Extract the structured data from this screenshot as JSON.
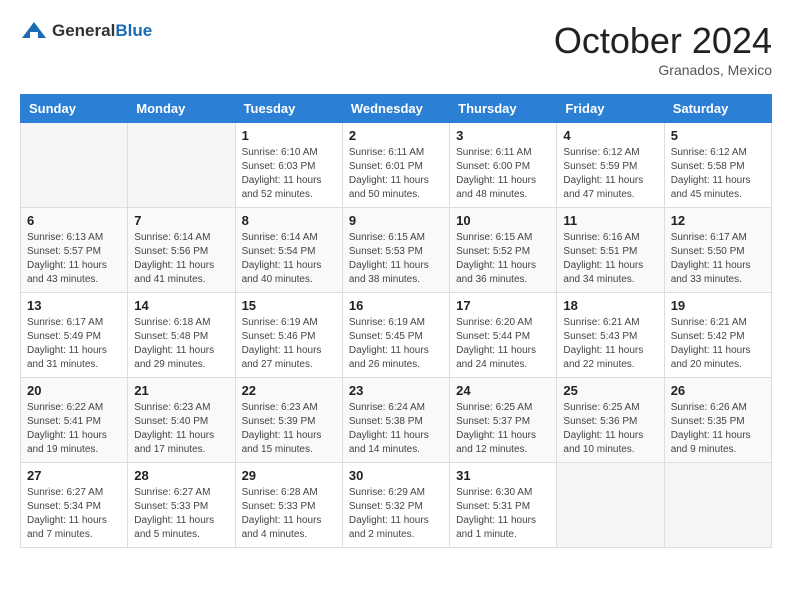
{
  "logo": {
    "general": "General",
    "blue": "Blue"
  },
  "header": {
    "month": "October 2024",
    "location": "Granados, Mexico"
  },
  "weekdays": [
    "Sunday",
    "Monday",
    "Tuesday",
    "Wednesday",
    "Thursday",
    "Friday",
    "Saturday"
  ],
  "weeks": [
    [
      {
        "day": "",
        "sunrise": "",
        "sunset": "",
        "daylight": ""
      },
      {
        "day": "",
        "sunrise": "",
        "sunset": "",
        "daylight": ""
      },
      {
        "day": "1",
        "sunrise": "Sunrise: 6:10 AM",
        "sunset": "Sunset: 6:03 PM",
        "daylight": "Daylight: 11 hours and 52 minutes."
      },
      {
        "day": "2",
        "sunrise": "Sunrise: 6:11 AM",
        "sunset": "Sunset: 6:01 PM",
        "daylight": "Daylight: 11 hours and 50 minutes."
      },
      {
        "day": "3",
        "sunrise": "Sunrise: 6:11 AM",
        "sunset": "Sunset: 6:00 PM",
        "daylight": "Daylight: 11 hours and 48 minutes."
      },
      {
        "day": "4",
        "sunrise": "Sunrise: 6:12 AM",
        "sunset": "Sunset: 5:59 PM",
        "daylight": "Daylight: 11 hours and 47 minutes."
      },
      {
        "day": "5",
        "sunrise": "Sunrise: 6:12 AM",
        "sunset": "Sunset: 5:58 PM",
        "daylight": "Daylight: 11 hours and 45 minutes."
      }
    ],
    [
      {
        "day": "6",
        "sunrise": "Sunrise: 6:13 AM",
        "sunset": "Sunset: 5:57 PM",
        "daylight": "Daylight: 11 hours and 43 minutes."
      },
      {
        "day": "7",
        "sunrise": "Sunrise: 6:14 AM",
        "sunset": "Sunset: 5:56 PM",
        "daylight": "Daylight: 11 hours and 41 minutes."
      },
      {
        "day": "8",
        "sunrise": "Sunrise: 6:14 AM",
        "sunset": "Sunset: 5:54 PM",
        "daylight": "Daylight: 11 hours and 40 minutes."
      },
      {
        "day": "9",
        "sunrise": "Sunrise: 6:15 AM",
        "sunset": "Sunset: 5:53 PM",
        "daylight": "Daylight: 11 hours and 38 minutes."
      },
      {
        "day": "10",
        "sunrise": "Sunrise: 6:15 AM",
        "sunset": "Sunset: 5:52 PM",
        "daylight": "Daylight: 11 hours and 36 minutes."
      },
      {
        "day": "11",
        "sunrise": "Sunrise: 6:16 AM",
        "sunset": "Sunset: 5:51 PM",
        "daylight": "Daylight: 11 hours and 34 minutes."
      },
      {
        "day": "12",
        "sunrise": "Sunrise: 6:17 AM",
        "sunset": "Sunset: 5:50 PM",
        "daylight": "Daylight: 11 hours and 33 minutes."
      }
    ],
    [
      {
        "day": "13",
        "sunrise": "Sunrise: 6:17 AM",
        "sunset": "Sunset: 5:49 PM",
        "daylight": "Daylight: 11 hours and 31 minutes."
      },
      {
        "day": "14",
        "sunrise": "Sunrise: 6:18 AM",
        "sunset": "Sunset: 5:48 PM",
        "daylight": "Daylight: 11 hours and 29 minutes."
      },
      {
        "day": "15",
        "sunrise": "Sunrise: 6:19 AM",
        "sunset": "Sunset: 5:46 PM",
        "daylight": "Daylight: 11 hours and 27 minutes."
      },
      {
        "day": "16",
        "sunrise": "Sunrise: 6:19 AM",
        "sunset": "Sunset: 5:45 PM",
        "daylight": "Daylight: 11 hours and 26 minutes."
      },
      {
        "day": "17",
        "sunrise": "Sunrise: 6:20 AM",
        "sunset": "Sunset: 5:44 PM",
        "daylight": "Daylight: 11 hours and 24 minutes."
      },
      {
        "day": "18",
        "sunrise": "Sunrise: 6:21 AM",
        "sunset": "Sunset: 5:43 PM",
        "daylight": "Daylight: 11 hours and 22 minutes."
      },
      {
        "day": "19",
        "sunrise": "Sunrise: 6:21 AM",
        "sunset": "Sunset: 5:42 PM",
        "daylight": "Daylight: 11 hours and 20 minutes."
      }
    ],
    [
      {
        "day": "20",
        "sunrise": "Sunrise: 6:22 AM",
        "sunset": "Sunset: 5:41 PM",
        "daylight": "Daylight: 11 hours and 19 minutes."
      },
      {
        "day": "21",
        "sunrise": "Sunrise: 6:23 AM",
        "sunset": "Sunset: 5:40 PM",
        "daylight": "Daylight: 11 hours and 17 minutes."
      },
      {
        "day": "22",
        "sunrise": "Sunrise: 6:23 AM",
        "sunset": "Sunset: 5:39 PM",
        "daylight": "Daylight: 11 hours and 15 minutes."
      },
      {
        "day": "23",
        "sunrise": "Sunrise: 6:24 AM",
        "sunset": "Sunset: 5:38 PM",
        "daylight": "Daylight: 11 hours and 14 minutes."
      },
      {
        "day": "24",
        "sunrise": "Sunrise: 6:25 AM",
        "sunset": "Sunset: 5:37 PM",
        "daylight": "Daylight: 11 hours and 12 minutes."
      },
      {
        "day": "25",
        "sunrise": "Sunrise: 6:25 AM",
        "sunset": "Sunset: 5:36 PM",
        "daylight": "Daylight: 11 hours and 10 minutes."
      },
      {
        "day": "26",
        "sunrise": "Sunrise: 6:26 AM",
        "sunset": "Sunset: 5:35 PM",
        "daylight": "Daylight: 11 hours and 9 minutes."
      }
    ],
    [
      {
        "day": "27",
        "sunrise": "Sunrise: 6:27 AM",
        "sunset": "Sunset: 5:34 PM",
        "daylight": "Daylight: 11 hours and 7 minutes."
      },
      {
        "day": "28",
        "sunrise": "Sunrise: 6:27 AM",
        "sunset": "Sunset: 5:33 PM",
        "daylight": "Daylight: 11 hours and 5 minutes."
      },
      {
        "day": "29",
        "sunrise": "Sunrise: 6:28 AM",
        "sunset": "Sunset: 5:33 PM",
        "daylight": "Daylight: 11 hours and 4 minutes."
      },
      {
        "day": "30",
        "sunrise": "Sunrise: 6:29 AM",
        "sunset": "Sunset: 5:32 PM",
        "daylight": "Daylight: 11 hours and 2 minutes."
      },
      {
        "day": "31",
        "sunrise": "Sunrise: 6:30 AM",
        "sunset": "Sunset: 5:31 PM",
        "daylight": "Daylight: 11 hours and 1 minute."
      },
      {
        "day": "",
        "sunrise": "",
        "sunset": "",
        "daylight": ""
      },
      {
        "day": "",
        "sunrise": "",
        "sunset": "",
        "daylight": ""
      }
    ]
  ]
}
